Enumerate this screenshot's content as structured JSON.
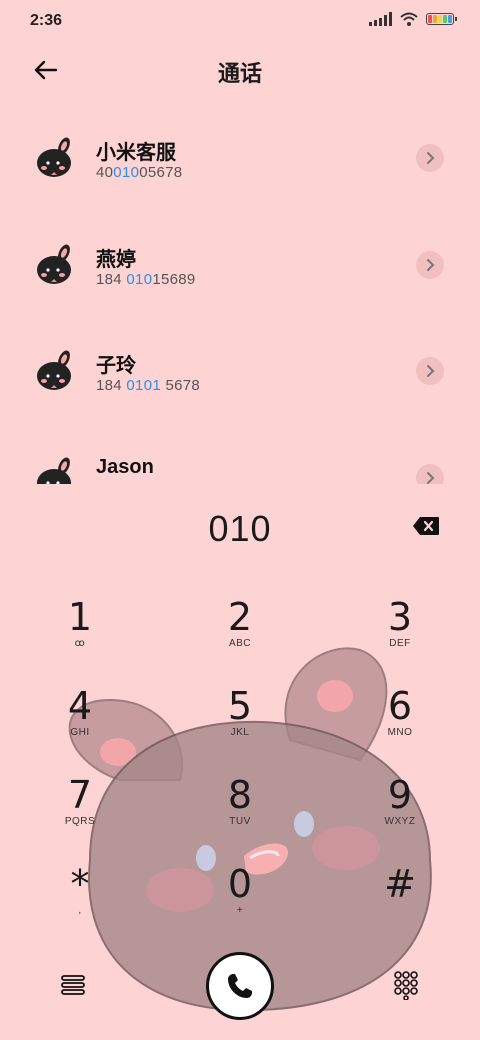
{
  "status": {
    "time": "2:36",
    "icons": [
      "signal-icon",
      "wifi-icon",
      "battery-icon"
    ]
  },
  "header": {
    "title": "通话",
    "back_icon": "back-arrow-icon"
  },
  "contacts": [
    {
      "name": "小米客服",
      "number_pre": "40",
      "number_match": "010",
      "number_post": "05678"
    },
    {
      "name": "燕婷",
      "number_pre": "184 ",
      "number_match": "010",
      "number_post": "15689"
    },
    {
      "name": "子玲",
      "number_pre": "184 ",
      "number_match": "0101",
      "number_post": " 5678"
    },
    {
      "name": "Jason",
      "number_pre": "",
      "number_match": "",
      "number_post": ""
    }
  ],
  "dial": {
    "number": "010",
    "backspace_icon": "backspace-icon"
  },
  "keypad": [
    {
      "digit": "1",
      "letters": "ꝏ"
    },
    {
      "digit": "2",
      "letters": "ABC"
    },
    {
      "digit": "3",
      "letters": "DEF"
    },
    {
      "digit": "4",
      "letters": "GHI"
    },
    {
      "digit": "5",
      "letters": "JKL"
    },
    {
      "digit": "6",
      "letters": "MNO"
    },
    {
      "digit": "7",
      "letters": "PQRS"
    },
    {
      "digit": "8",
      "letters": "TUV"
    },
    {
      "digit": "9",
      "letters": "WXYZ"
    },
    {
      "digit": "*",
      "letters": ","
    },
    {
      "digit": "0",
      "letters": "+"
    },
    {
      "digit": "#",
      "letters": ""
    }
  ],
  "bottom": {
    "menu_icon": "menu-icon",
    "call_icon": "phone-icon",
    "keypad_icon": "dialpad-icon"
  },
  "colors": {
    "background": "#fdd3d3",
    "highlight": "#2f8fe0",
    "text": "#1a1a1a"
  }
}
